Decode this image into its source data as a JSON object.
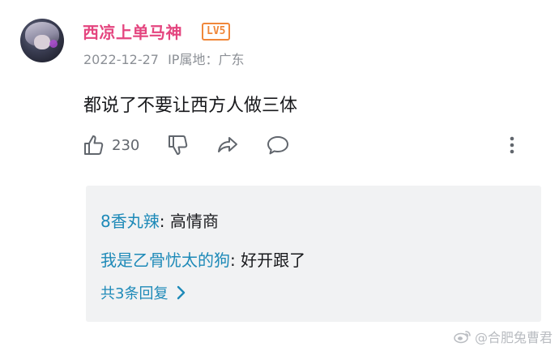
{
  "comment": {
    "username": "西凉上单马神",
    "level": "LV5",
    "date": "2022-12-27",
    "location": "IP属地：广东",
    "text": "都说了不要让西方人做三体",
    "like_count": "230"
  },
  "replies": {
    "items": [
      {
        "user": "8香丸辣",
        "separator": ": ",
        "text": "高情商"
      },
      {
        "user": "我是乙骨忧太的狗",
        "separator": ": ",
        "text": "好开跟了"
      }
    ],
    "more_label": "共3条回复"
  },
  "watermark": {
    "text": "@合肥兔曹君"
  },
  "colors": {
    "username": "#e4457f",
    "level_badge": "#f0873a",
    "reply_user": "#1e8ab8",
    "reply_bg": "#f1f2f3",
    "meta": "#8c9096"
  },
  "icons": [
    "like-icon",
    "dislike-icon",
    "share-icon",
    "reply-icon",
    "more-icon",
    "chevron-right-icon",
    "weibo-icon"
  ]
}
